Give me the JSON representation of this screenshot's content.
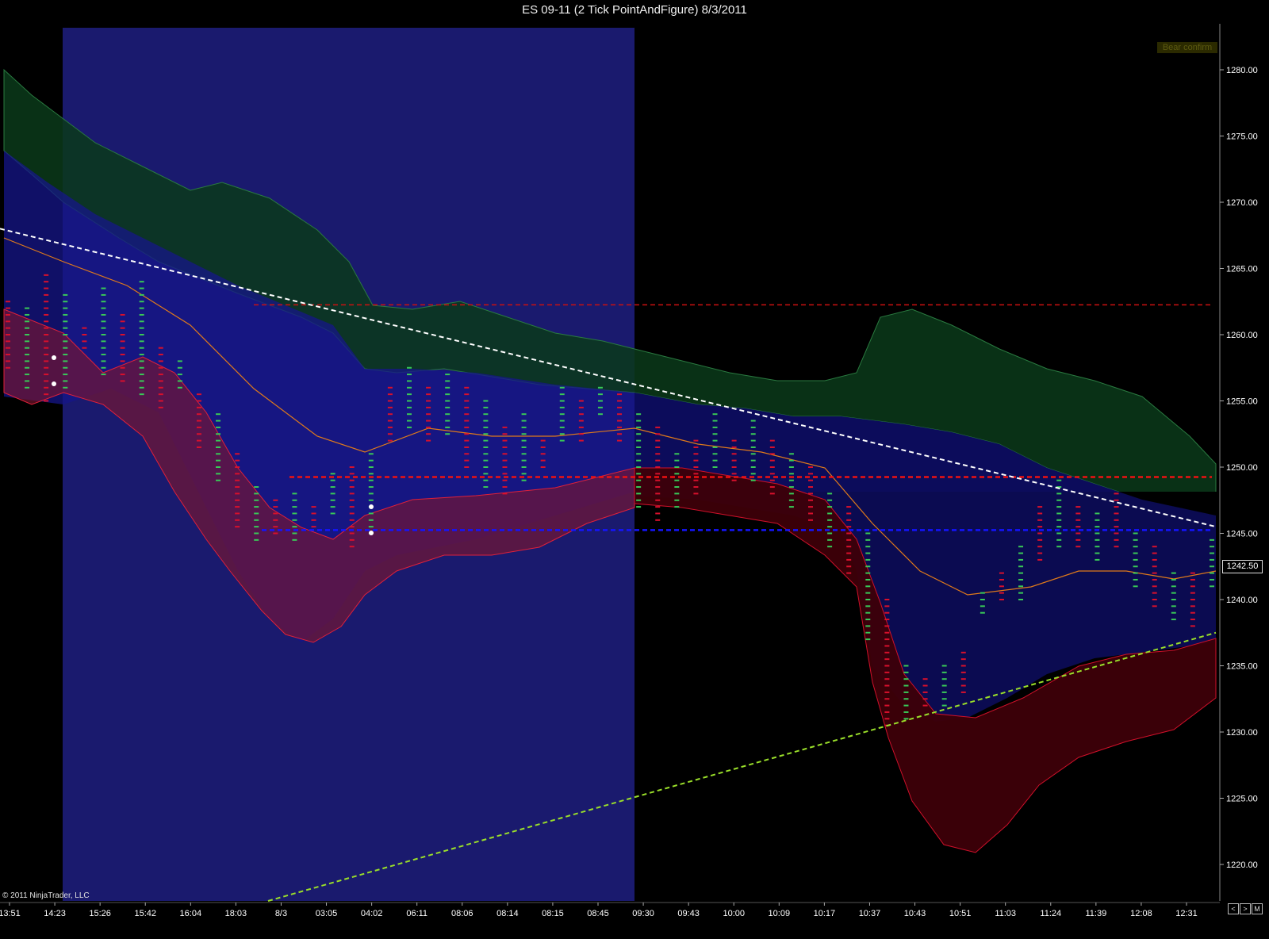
{
  "title": "ES 09-11 (2 Tick PointAndFigure)  8/3/2011",
  "copyright": "© 2011 NinjaTrader, LLC",
  "badge": "Bear confirm",
  "last_price": "1242.50",
  "nav": {
    "left": "<",
    "right": ">",
    "menu": "M"
  },
  "colors": {
    "background": "#000000",
    "session_shade": "#1a1a6e",
    "box_up": "#39c957",
    "box_down": "#d8102c",
    "upper_band": "#0b3a1a",
    "lower_band": "#5a0a14",
    "white_trendline": "#ffffff",
    "green_trendline": "#9adf2a",
    "resistance": "#cc1111",
    "support": "#1414ff",
    "ma": "#e07a1a"
  },
  "chart_data": {
    "type": "point_and_figure",
    "yticks": [
      1220,
      1225,
      1230,
      1235,
      1240,
      1245,
      1250,
      1255,
      1260,
      1265,
      1270,
      1275,
      1280
    ],
    "ytick_labels": [
      "1220.00",
      "1225.00",
      "1230.00",
      "1235.00",
      "1240.00",
      "1245.00",
      "1250.00",
      "1255.00",
      "1260.00",
      "1265.00",
      "1270.00",
      "1275.00",
      "1280.00"
    ],
    "ylim": [
      1217,
      1283
    ],
    "xtick_labels": [
      "13:51",
      "14:23",
      "15:26",
      "15:42",
      "16:04",
      "18:03",
      "8/3",
      "03:05",
      "04:02",
      "06:11",
      "08:06",
      "08:14",
      "08:15",
      "08:45",
      "09:30",
      "09:43",
      "10:00",
      "10:09",
      "10:17",
      "10:37",
      "10:43",
      "10:51",
      "11:03",
      "11:24",
      "11:39",
      "12:08",
      "12:31"
    ],
    "horizontal_lines": [
      {
        "price": 1262.25,
        "color": "#cc1111",
        "style": "dashed"
      },
      {
        "price": 1249.25,
        "color": "#ee1111",
        "style": "dashed"
      },
      {
        "price": 1245.25,
        "color": "#1414ff",
        "style": "dashed"
      }
    ],
    "trendlines": [
      {
        "color": "#ffffff",
        "from_price": 1268.0,
        "to_price": 1245.5
      },
      {
        "color": "#9adf2a",
        "from_price": 1214.5,
        "to_price": 1237.5
      }
    ],
    "columns": [
      1262.5,
      1257.5,
      1262,
      1256,
      1264.5,
      1255,
      1263,
      1256,
      1260.5,
      1259,
      1263.5,
      1257,
      1261.5,
      1256.5,
      1264,
      1255.5,
      1259,
      1254.5,
      1258,
      1256,
      1255.5,
      1251.5,
      1254,
      1249,
      1251,
      1245.5,
      1248.5,
      1244.5,
      1247.5,
      1245,
      1248,
      1244.5,
      1247,
      1245.5,
      1249.5,
      1246.5,
      1250,
      1244,
      1251,
      1245,
      1256,
      1252,
      1257.5,
      1253,
      1256,
      1252,
      1257,
      1252.5,
      1256,
      1250,
      1255,
      1248.5,
      1253,
      1248,
      1254,
      1249,
      1252,
      1250,
      1256,
      1252,
      1255,
      1252,
      1256,
      1254,
      1255.5,
      1252,
      1254,
      1247,
      1253,
      1246,
      1251,
      1247,
      1252,
      1248,
      1254,
      1250,
      1252,
      1249,
      1253.5,
      1249,
      1252,
      1248,
      1251,
      1247,
      1250,
      1246,
      1248,
      1244,
      1247,
      1242,
      1245,
      1237,
      1240,
      1230.5,
      1235,
      1231,
      1234,
      1232,
      1235,
      1232,
      1236,
      1233,
      1240.5,
      1239,
      1242,
      1240,
      1244,
      1240,
      1247,
      1243,
      1249,
      1244,
      1247,
      1244,
      1246.5,
      1243,
      1248,
      1244,
      1245,
      1241,
      1244,
      1239.5,
      1242,
      1238.5,
      1242,
      1238,
      1244.5,
      1241
    ]
  }
}
